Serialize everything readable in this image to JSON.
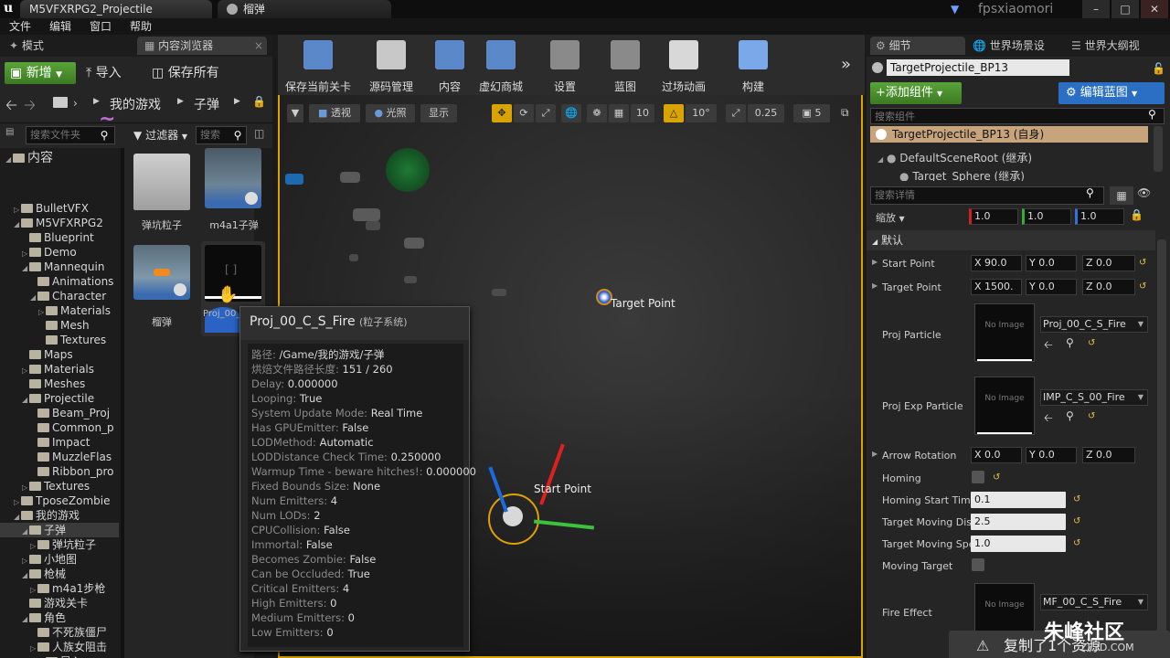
{
  "titlebar": {
    "logo": "u",
    "tabs": [
      {
        "label": "M5VFXRPG2_Projectile"
      },
      {
        "label": "榴弹"
      }
    ],
    "user": "fpsxiaomori",
    "controls": [
      "minimize-icon",
      "maximize-icon",
      "close-icon"
    ]
  },
  "menu": [
    "文件",
    "编辑",
    "窗口",
    "帮助"
  ],
  "left_panel": {
    "tabs": [
      "模式",
      "内容浏览器"
    ],
    "add_new": "新增",
    "import": "导入",
    "save_all": "保存所有",
    "breadcrumb": [
      "我的游戏",
      "子弹"
    ],
    "search_folders_placeholder": "搜索文件夹",
    "filter": "过滤器",
    "search_assets_placeholder": "搜索",
    "tree_root": "内容",
    "tree": [
      {
        "label": "BulletVFX",
        "depth": 1,
        "exp": "right"
      },
      {
        "label": "M5VFXRPG2",
        "depth": 1,
        "exp": "down"
      },
      {
        "label": "Blueprint",
        "depth": 2,
        "exp": ""
      },
      {
        "label": "Demo",
        "depth": 2,
        "exp": "right"
      },
      {
        "label": "Mannequin",
        "depth": 2,
        "exp": "down"
      },
      {
        "label": "Animations",
        "depth": 3,
        "exp": ""
      },
      {
        "label": "Character",
        "depth": 3,
        "exp": "down"
      },
      {
        "label": "Materials",
        "depth": 4,
        "exp": "right"
      },
      {
        "label": "Mesh",
        "depth": 4,
        "exp": ""
      },
      {
        "label": "Textures",
        "depth": 4,
        "exp": ""
      },
      {
        "label": "Maps",
        "depth": 2,
        "exp": ""
      },
      {
        "label": "Materials",
        "depth": 2,
        "exp": "right"
      },
      {
        "label": "Meshes",
        "depth": 2,
        "exp": ""
      },
      {
        "label": "Projectile",
        "depth": 2,
        "exp": "down"
      },
      {
        "label": "Beam_Proj",
        "depth": 3,
        "exp": ""
      },
      {
        "label": "Common_p",
        "depth": 3,
        "exp": ""
      },
      {
        "label": "Impact",
        "depth": 3,
        "exp": ""
      },
      {
        "label": "MuzzleFlas",
        "depth": 3,
        "exp": ""
      },
      {
        "label": "Ribbon_pro",
        "depth": 3,
        "exp": ""
      },
      {
        "label": "Textures",
        "depth": 2,
        "exp": "right"
      },
      {
        "label": "TposeZombie",
        "depth": 1,
        "exp": "right"
      },
      {
        "label": "我的游戏",
        "depth": 1,
        "exp": "down"
      },
      {
        "label": "子弹",
        "depth": 2,
        "exp": "down",
        "selected": true
      },
      {
        "label": "弹坑粒子",
        "depth": 3,
        "exp": "right"
      },
      {
        "label": "小地图",
        "depth": 2,
        "exp": "right"
      },
      {
        "label": "枪械",
        "depth": 2,
        "exp": "down"
      },
      {
        "label": "m4a1步枪",
        "depth": 3,
        "exp": "right"
      },
      {
        "label": "游戏关卡",
        "depth": 2,
        "exp": ""
      },
      {
        "label": "角色",
        "depth": 2,
        "exp": "down"
      },
      {
        "label": "不死族僵尸",
        "depth": 3,
        "exp": ""
      },
      {
        "label": "人族女阻击",
        "depth": 3,
        "exp": "right"
      },
      {
        "label": "导入",
        "depth": 4,
        "exp": "right"
      }
    ],
    "assets": [
      {
        "label": "弹坑粒子"
      },
      {
        "label": "m4a1子弹"
      },
      {
        "label": "榴弹"
      },
      {
        "label": "Proj_00_C_S_Fire"
      }
    ]
  },
  "toolbar": [
    {
      "label": "保存当前关卡",
      "icon": "save-icon"
    },
    {
      "label": "源码管理",
      "icon": "source-control-icon"
    },
    {
      "label": "内容",
      "icon": "content-icon"
    },
    {
      "label": "虚幻商城",
      "icon": "marketplace-icon"
    },
    {
      "label": "设置",
      "icon": "settings-icon"
    },
    {
      "label": "蓝图",
      "icon": "blueprint-icon"
    },
    {
      "label": "过场动画",
      "icon": "cinematics-icon"
    },
    {
      "label": "构建",
      "icon": "build-icon"
    }
  ],
  "viewport": {
    "perspective": "透视",
    "lit": "光照",
    "show": "显示",
    "grid_snap": "10",
    "rot_snap": "10°",
    "scale_snap": "0.25",
    "cam_speed": "5",
    "target_point_label": "Target Point",
    "start_point_label": "Start Point"
  },
  "tooltip": {
    "title": "Proj_00_C_S_Fire",
    "subtitle": "(粒子系统)",
    "rows": [
      {
        "k": "路径:",
        "v": "/Game/我的游戏/子弹"
      },
      {
        "k": "烘焙文件路径长度:",
        "v": "151 / 260"
      },
      {
        "k": "Delay:",
        "v": "0.000000"
      },
      {
        "k": "Looping:",
        "v": "True"
      },
      {
        "k": "System Update Mode:",
        "v": "Real Time"
      },
      {
        "k": "Has GPUEmitter:",
        "v": "False"
      },
      {
        "k": "LODMethod:",
        "v": "Automatic"
      },
      {
        "k": "LODDistance Check Time:",
        "v": "0.250000"
      },
      {
        "k": "Warmup Time - beware hitches!:",
        "v": "0.000000"
      },
      {
        "k": "Fixed Bounds Size:",
        "v": "None"
      },
      {
        "k": "Num Emitters:",
        "v": "4"
      },
      {
        "k": "Num LODs:",
        "v": "2"
      },
      {
        "k": "CPUCollision:",
        "v": "False"
      },
      {
        "k": "Immortal:",
        "v": "False"
      },
      {
        "k": "Becomes Zombie:",
        "v": "False"
      },
      {
        "k": "Can be Occluded:",
        "v": "True"
      },
      {
        "k": "Critical Emitters:",
        "v": "4"
      },
      {
        "k": "High Emitters:",
        "v": "0"
      },
      {
        "k": "Medium Emitters:",
        "v": "0"
      },
      {
        "k": "Low Emitters:",
        "v": "0"
      }
    ]
  },
  "right_panel": {
    "tabs": [
      "细节",
      "世界场景设",
      "世界大纲视"
    ],
    "object_name": "TargetProjectile_BP13",
    "add_component": "+添加组件",
    "edit_blueprint": "编辑蓝图",
    "search_components_placeholder": "搜索组件",
    "components": [
      "TargetProjectile_BP13 (自身)",
      "DefaultSceneRoot (继承)",
      "Target_Sphere (继承)"
    ],
    "search_details_placeholder": "搜索详情",
    "scale_label": "缩放",
    "scale": [
      "1.0",
      "1.0",
      "1.0"
    ],
    "section_default": "默认",
    "start_point": {
      "label": "Start Point",
      "x": "X 90.0",
      "y": "Y 0.0",
      "z": "Z 0.0"
    },
    "target_point": {
      "label": "Target Point",
      "x": "X 1500.",
      "y": "Y 0.0",
      "z": "Z 0.0"
    },
    "proj_particle": {
      "label": "Proj Particle",
      "value": "Proj_00_C_S_Fire"
    },
    "proj_exp_particle": {
      "label": "Proj Exp Particle",
      "value": "IMP_C_S_00_Fire"
    },
    "arrow_rotation": {
      "label": "Arrow Rotation",
      "x": "X 0.0",
      "y": "Y 0.0",
      "z": "Z 0.0"
    },
    "homing": "Homing",
    "homing_start_time": {
      "label": "Homing Start Time",
      "value": "0.1"
    },
    "target_moving_dist": {
      "label": "Target Moving Dis",
      "value": "2.5"
    },
    "target_moving_speed": {
      "label": "Target Moving Spe",
      "value": "1.0"
    },
    "moving_target": "Moving Target",
    "fire_effect": {
      "label": "Fire Effect",
      "value": "MF_00_C_S_Fire"
    },
    "no_image": "No Image"
  },
  "notification": "复制了1个资源",
  "watermark": "朱峰社区",
  "watermark_url": "ZF3D.COM",
  "colors": {
    "accent_green": "#4c962e",
    "accent_blue": "#2a6fc4",
    "viewport_border": "#d9a400",
    "selection_tan": "#c8a47c"
  }
}
